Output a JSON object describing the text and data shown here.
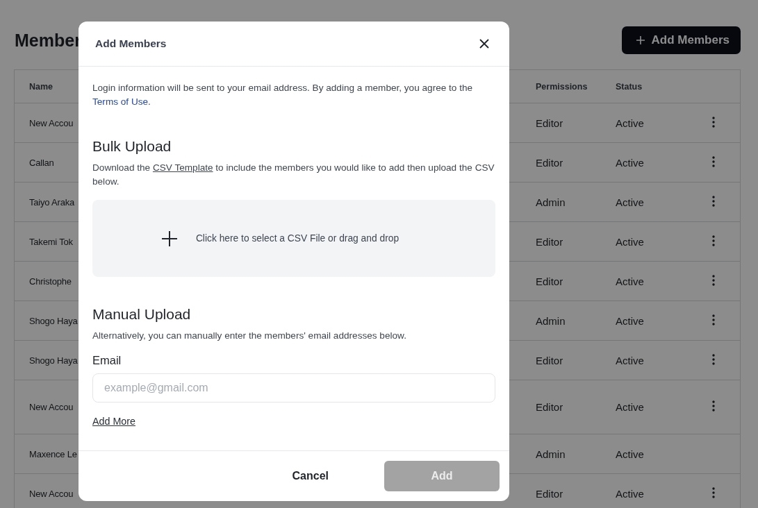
{
  "page": {
    "title": "Member",
    "add_button": "Add Members"
  },
  "table": {
    "columns": [
      "Name",
      "Permissions",
      "Status"
    ],
    "rows": [
      {
        "name": "New Accou",
        "permission": "Editor",
        "status": "Active",
        "has_menu": true
      },
      {
        "name": "Callan",
        "permission": "Editor",
        "status": "Active",
        "has_menu": true
      },
      {
        "name": "Taiyo Araka",
        "permission": "Admin",
        "status": "Active",
        "has_menu": true
      },
      {
        "name": "Takemi Tok",
        "permission": "Editor",
        "status": "Active",
        "has_menu": true
      },
      {
        "name": "Christophe",
        "permission": "Editor",
        "status": "Active",
        "has_menu": true
      },
      {
        "name": "Shogo Haya",
        "permission": "Admin",
        "status": "Active",
        "has_menu": true
      },
      {
        "name": "Shogo Haya",
        "permission": "Editor",
        "status": "Active",
        "has_menu": true
      },
      {
        "name": "New Accou",
        "permission": "Editor",
        "status": "Active",
        "has_menu": true
      },
      {
        "name": "Maxence Le",
        "permission": "Admin",
        "status": "Active",
        "has_menu": false
      },
      {
        "name": "New Accou",
        "permission": "Editor",
        "status": "Active",
        "has_menu": true
      }
    ]
  },
  "dialog": {
    "title": "Add Members",
    "intro": {
      "text": "Login information will be sent to your email address. By adding a member, you agree to the",
      "link": "Terms of Use",
      "after": "."
    },
    "bulk": {
      "heading": "Bulk Upload",
      "before": "Download the",
      "link": "CSV Template",
      "after": "to include the members you would like to add then upload the CSV below.",
      "dropzone": "Click here to select a CSV File or drag and drop"
    },
    "manual": {
      "heading": "Manual Upload",
      "description": "Alternatively, you can manually enter the members' email addresses below.",
      "field_label": "Email",
      "placeholder": "example@gmail.com",
      "add_more": "Add More"
    },
    "cancel_button": "Cancel",
    "add_button": {
      "label": "Add",
      "disabled": true
    }
  }
}
